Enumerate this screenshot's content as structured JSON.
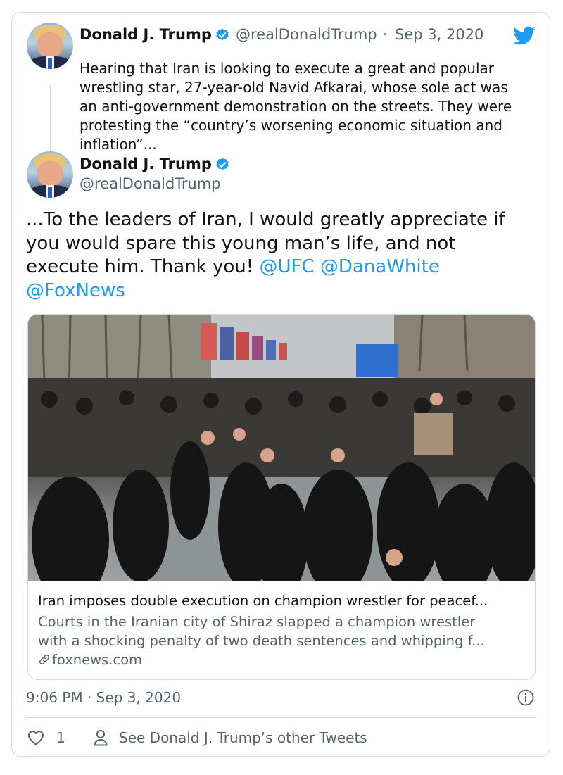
{
  "first_tweet": {
    "name": "Donald J. Trump",
    "handle": "@realDonaldTrump",
    "separator": "·",
    "date": "Sep 3, 2020",
    "text_lines": [
      "Hearing that Iran is looking to execute a great and popular",
      "wrestling star, 27-year-old Navid Afkarai, whose sole act was",
      "an anti-government demonstration on the streets. They were",
      "protesting the “country’s worsening economic situation and",
      "inflation”..."
    ]
  },
  "main_tweet": {
    "name": "Donald J. Trump",
    "handle": "@realDonaldTrump",
    "text_lines": [
      "...To the leaders of Iran, I would greatly appreciate if",
      "you would spare this young man’s life, and not",
      "execute him. Thank you! "
    ],
    "mentions": [
      "@UFC",
      "@DanaWhite",
      "@FoxNews"
    ]
  },
  "link_card": {
    "title": "Iran imposes double execution on champion wrestler for peacef...",
    "description_lines": [
      "Courts in the Iranian city of Shiraz slapped a champion wrestler",
      "with a shocking penalty of two death sentences and whipping f..."
    ],
    "domain": "foxnews.com",
    "image": "crowd-protest-photo"
  },
  "footer": {
    "timestamp": "9:06 PM · Sep 3, 2020",
    "like_count": "1",
    "see_other": "See Donald J. Trump’s other Tweets"
  },
  "icons": {
    "brand": "twitter-bird-icon",
    "verified": "verified-badge-icon",
    "info": "info-icon",
    "like": "heart-icon",
    "profile": "user-icon",
    "link": "link-icon"
  },
  "colors": {
    "accent": "#1d9bf0",
    "text": "#0f1419",
    "secondary": "#536471",
    "border": "#cfd9de"
  }
}
